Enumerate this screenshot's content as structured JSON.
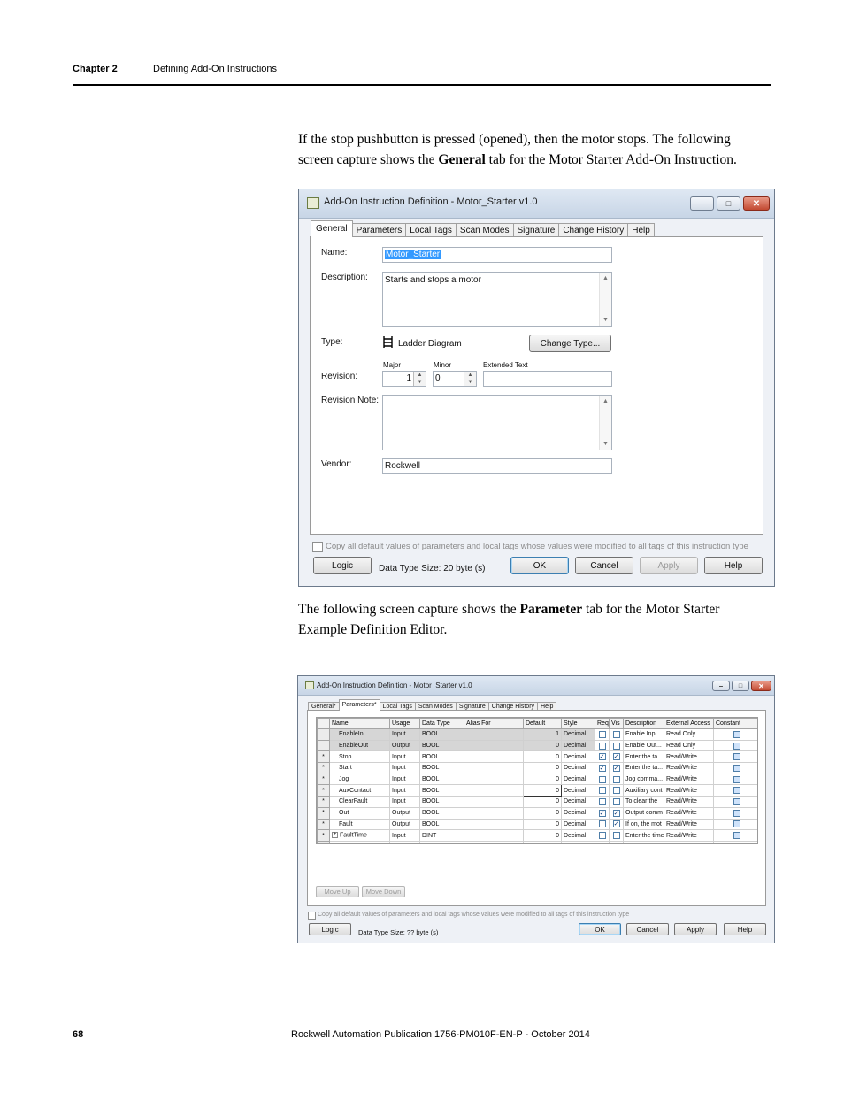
{
  "header": {
    "chapter": "Chapter 2",
    "section": "Defining Add-On Instructions"
  },
  "intro": {
    "p1_a": "If the stop pushbutton is pressed (opened), then the motor stops. The following screen  capture shows the ",
    "p1_bold": "General",
    "p1_b": " tab for the Motor Starter Add-On Instruction.",
    "p2_a": "The following screen  capture shows the ",
    "p2_bold": "Parameter",
    "p2_b": " tab for the Motor Starter Example Definition Editor."
  },
  "dialog1": {
    "title": "Add-On Instruction Definition - Motor_Starter v1.0",
    "tabs": [
      "General",
      "Parameters",
      "Local Tags",
      "Scan Modes",
      "Signature",
      "Change History",
      "Help"
    ],
    "name_label": "Name:",
    "name_value": "Motor_Starter",
    "description_label": "Description:",
    "description_value": "Starts and stops a motor",
    "type_label": "Type:",
    "type_value": "Ladder Diagram",
    "change_type_button": "Change Type...",
    "major_label": "Major",
    "minor_label": "Minor",
    "extended_label": "Extended Text",
    "revision_label": "Revision:",
    "major_value": "1",
    "minor_value": "0",
    "revision_note_label": "Revision Note:",
    "vendor_label": "Vendor:",
    "vendor_value": "Rockwell",
    "copy_defaults": "Copy all default values of parameters and local tags whose values were modified to all tags of this instruction type",
    "logic_button": "Logic",
    "data_type_size": "Data Type Size: 20 byte (s)",
    "ok_button": "OK",
    "cancel_button": "Cancel",
    "apply_button": "Apply",
    "help_button": "Help"
  },
  "dialog2": {
    "title": "Add-On Instruction Definition - Motor_Starter v1.0",
    "tabs": [
      "General*",
      "Parameters*",
      "Local Tags",
      "Scan Modes",
      "Signature",
      "Change History",
      "Help"
    ],
    "columns": [
      "Name",
      "Usage",
      "Data Type",
      "Alias For",
      "Default",
      "Style",
      "Req",
      "Vis",
      "Description",
      "External Access",
      "Constant"
    ],
    "rows": [
      {
        "marker": "",
        "name": "EnableIn",
        "usage": "Input",
        "type": "BOOL",
        "alias": "",
        "default": "1",
        "style": "Decimal",
        "req": false,
        "vis": false,
        "desc": "Enable Inp...",
        "access": "Read Only",
        "const": false,
        "sys": true
      },
      {
        "marker": "",
        "name": "EnableOut",
        "usage": "Output",
        "type": "BOOL",
        "alias": "",
        "default": "0",
        "style": "Decimal",
        "req": false,
        "vis": false,
        "desc": "Enable Out...",
        "access": "Read Only",
        "const": false,
        "sys": true
      },
      {
        "marker": "*",
        "name": "Stop",
        "usage": "Input",
        "type": "BOOL",
        "alias": "",
        "default": "0",
        "style": "Decimal",
        "req": true,
        "vis": true,
        "desc": "Enter the ta...",
        "access": "Read/Write",
        "const": false,
        "sys": false
      },
      {
        "marker": "*",
        "name": "Start",
        "usage": "Input",
        "type": "BOOL",
        "alias": "",
        "default": "0",
        "style": "Decimal",
        "req": true,
        "vis": true,
        "desc": "Enter the ta...",
        "access": "Read/Write",
        "const": false,
        "sys": false
      },
      {
        "marker": "*",
        "name": "Jog",
        "usage": "Input",
        "type": "BOOL",
        "alias": "",
        "default": "0",
        "style": "Decimal",
        "req": false,
        "vis": false,
        "desc": "Jog comma...",
        "access": "Read/Write",
        "const": false,
        "sys": false
      },
      {
        "marker": "*",
        "name": "AuxContact",
        "usage": "Input",
        "type": "BOOL",
        "alias": "",
        "default": "0",
        "style": "Decimal",
        "req": false,
        "vis": false,
        "desc": "Auxiliary cont",
        "access": "Read/Write",
        "const": false,
        "sys": false
      },
      {
        "marker": "*",
        "name": "ClearFault",
        "usage": "Input",
        "type": "BOOL",
        "alias": "",
        "default": "0",
        "style": "Decimal",
        "req": false,
        "vis": false,
        "desc": "To clear the",
        "access": "Read/Write",
        "const": false,
        "sys": false
      },
      {
        "marker": "*",
        "name": "Out",
        "usage": "Output",
        "type": "BOOL",
        "alias": "",
        "default": "0",
        "style": "Decimal",
        "req": true,
        "vis": true,
        "desc": "Output comm",
        "access": "Read/Write",
        "const": false,
        "sys": false
      },
      {
        "marker": "*",
        "name": "Fault",
        "usage": "Output",
        "type": "BOOL",
        "alias": "",
        "default": "0",
        "style": "Decimal",
        "req": false,
        "vis": true,
        "desc": "If on, the mot",
        "access": "Read/Write",
        "const": false,
        "sys": false
      },
      {
        "marker": "*",
        "name": "FaultTime",
        "usage": "Input",
        "type": "DINT",
        "alias": "",
        "default": "0",
        "style": "Decimal",
        "req": false,
        "vis": false,
        "desc": "Enter the time",
        "access": "Read/Write",
        "const": false,
        "sys": false,
        "expand": "+"
      }
    ],
    "move_up": "Move Up",
    "move_down": "Move Down",
    "copy_defaults": "Copy all default values of parameters and local tags whose values were modified to all tags of this instruction type",
    "logic_button": "Logic",
    "data_type_size": "Data Type Size: ?? byte (s)",
    "ok_button": "OK",
    "cancel_button": "Cancel",
    "apply_button": "Apply",
    "help_button": "Help"
  },
  "footer": {
    "page_number": "68",
    "publication": "Rockwell  Automation Publication  1756-PM010F-EN-P  - October  2014"
  }
}
